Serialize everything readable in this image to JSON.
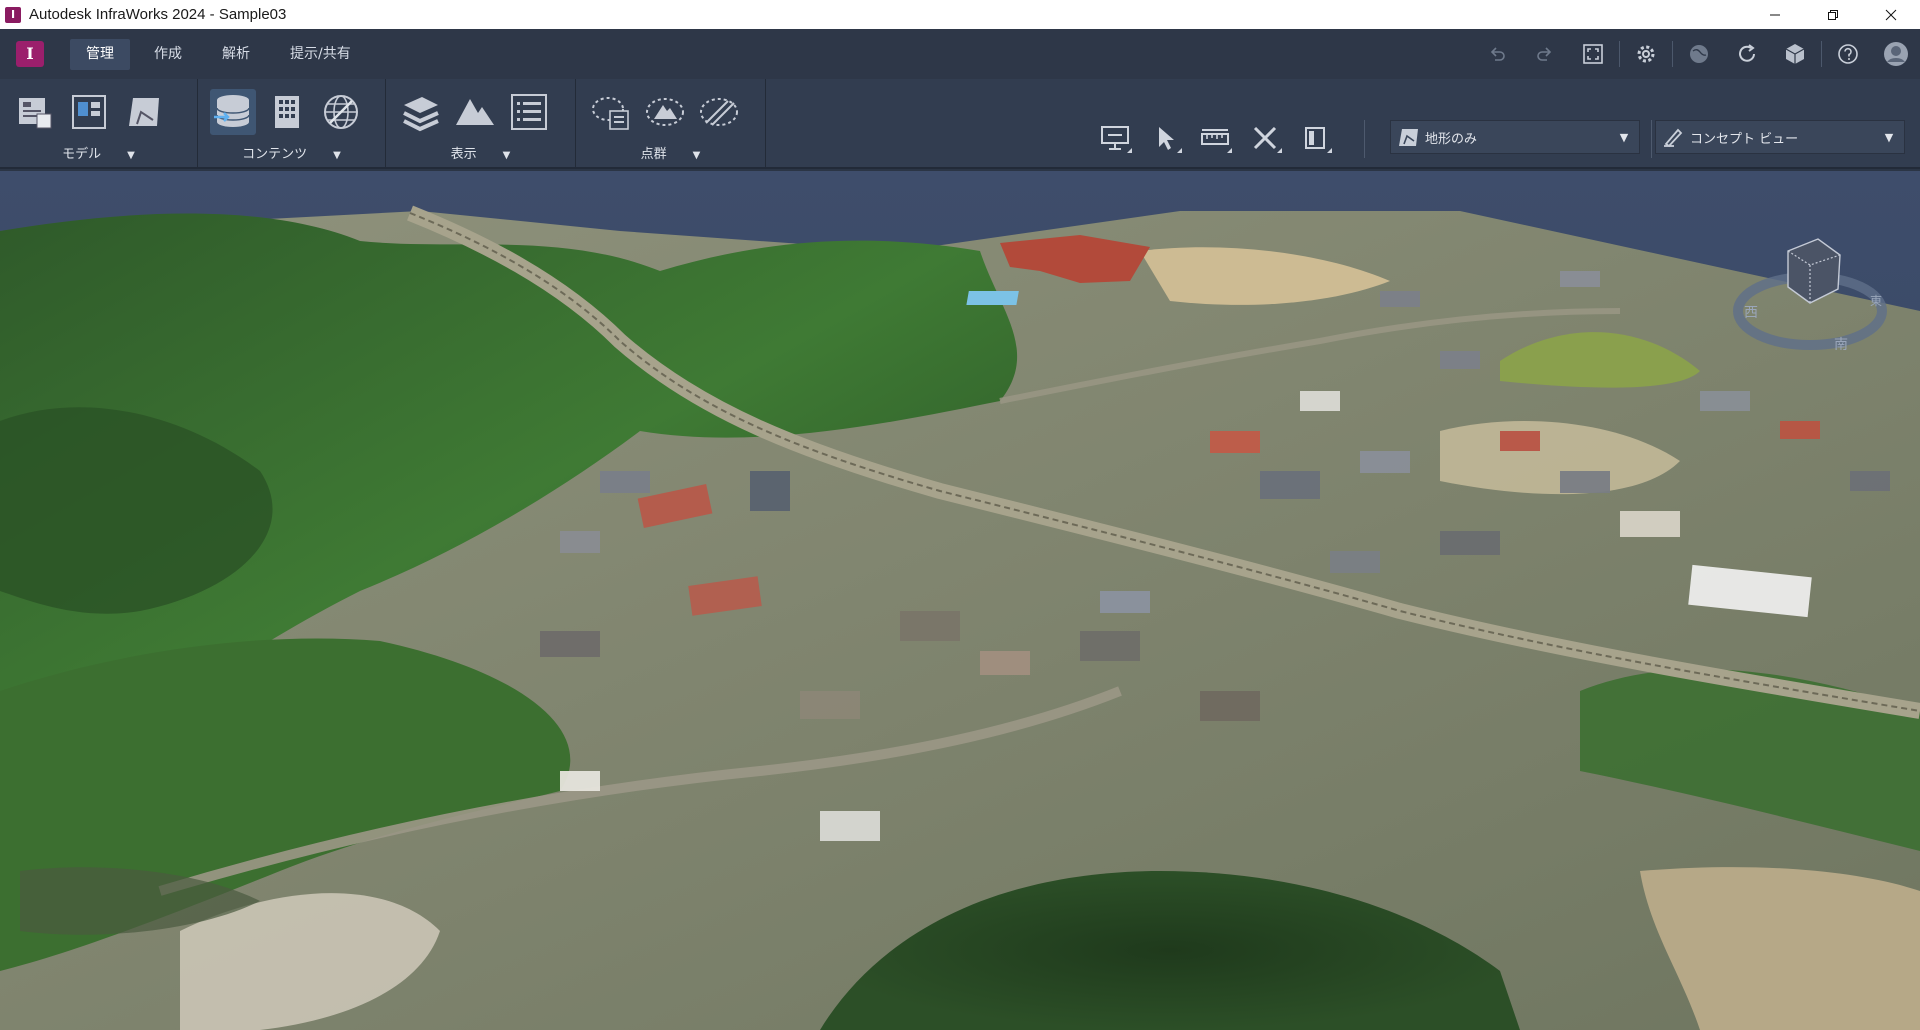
{
  "window": {
    "app_letter": "I",
    "title": "Autodesk InfraWorks 2024 - Sample03",
    "controls": [
      "minimize",
      "restore",
      "close"
    ]
  },
  "menubar": {
    "logo_letter": "I",
    "tabs": [
      {
        "label": "管理",
        "active": true
      },
      {
        "label": "作成",
        "active": false
      },
      {
        "label": "解析",
        "active": false
      },
      {
        "label": "提示/共有",
        "active": false
      }
    ],
    "quick_tools": [
      "undo-icon",
      "redo-icon",
      "fullscreen-icon",
      "settings-icon",
      "globe-icon",
      "sync-icon",
      "cube-icon",
      "help-icon",
      "user-icon"
    ]
  },
  "ribbon": {
    "panels": [
      {
        "label": "モデル",
        "icons": [
          "model-explorer-icon",
          "model-layout-icon",
          "model-surface-icon"
        ]
      },
      {
        "label": "コンテンツ",
        "icons": [
          "data-sources-icon",
          "buildings-grid-icon",
          "globe-mesh-icon"
        ]
      },
      {
        "label": "表示",
        "icons": [
          "layers-icon",
          "terrain-icon",
          "list-icon"
        ]
      },
      {
        "label": "点群",
        "icons": [
          "pointcloud-region-icon",
          "pointcloud-terrain-icon",
          "pointcloud-lines-icon"
        ]
      }
    ],
    "right_tools": [
      "presentation-icon",
      "select-icon",
      "measure-icon",
      "tools-icon",
      "panel-icon"
    ],
    "surface_dropdown": {
      "label": "地形のみ",
      "icon": "surface-icon"
    },
    "view_dropdown": {
      "label": "コンセプト ビュー",
      "icon": "pen-icon"
    }
  },
  "viewcube": {
    "labels": {
      "west": "西",
      "south": "南",
      "east": "東"
    }
  },
  "colors": {
    "titlebar": "#ffffff",
    "menubar": "#2e3748",
    "ribbon": "#323d50",
    "accent_logo": "#9b1f6c",
    "sky": "#3b4a66"
  }
}
